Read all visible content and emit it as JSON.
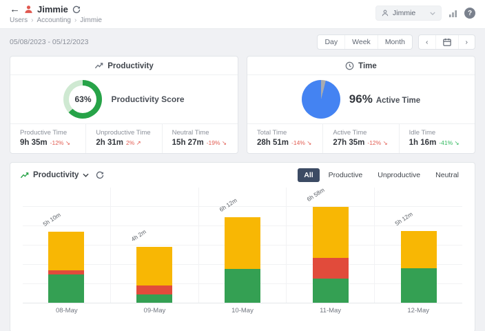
{
  "header": {
    "back_icon": "←",
    "title": "Jimmie",
    "breadcrumb": {
      "items": [
        "Users",
        "Accounting",
        "Jimmie"
      ],
      "separator": "›"
    },
    "user_select": {
      "value": "Jimmie"
    },
    "help_glyph": "?"
  },
  "toolbar": {
    "date_range": "05/08/2023 - 05/12/2023",
    "views": [
      "Day",
      "Week",
      "Month"
    ],
    "prev_glyph": "‹",
    "next_glyph": "›"
  },
  "productivity_card": {
    "title": "Productivity",
    "score": "63%",
    "score_label": "Productivity Score",
    "donut_color": "#27a348",
    "donut_rest_color": "#cfe9d2",
    "stats": [
      {
        "label": "Productive Time",
        "value": "9h 35m",
        "delta": "-12%",
        "arrow": "↘",
        "delta_color": "#e25c51"
      },
      {
        "label": "Unproductive Time",
        "value": "2h 31m",
        "delta": "2%",
        "arrow": "↗",
        "delta_color": "#e25c51"
      },
      {
        "label": "Neutral Time",
        "value": "15h 27m",
        "delta": "-19%",
        "arrow": "↘",
        "delta_color": "#e25c51"
      }
    ]
  },
  "time_card": {
    "title": "Time",
    "percent": "96%",
    "percent_label": "Active Time",
    "pie_color": "#4483f2",
    "pie_rest_color": "#a7abb0",
    "stats": [
      {
        "label": "Total Time",
        "value": "28h 51m",
        "delta": "-14%",
        "arrow": "↘",
        "delta_color": "#e25c51"
      },
      {
        "label": "Active Time",
        "value": "27h 35m",
        "delta": "-12%",
        "arrow": "↘",
        "delta_color": "#e25c51"
      },
      {
        "label": "Idle Time",
        "value": "1h 16m",
        "delta": "-41%",
        "arrow": "↘",
        "delta_color": "#2eb85c"
      }
    ]
  },
  "chart_card": {
    "selector_label": "Productivity",
    "filters": [
      "All",
      "Productive",
      "Unproductive",
      "Neutral"
    ],
    "active_filter": "All"
  },
  "chart_data": {
    "type": "bar",
    "stacked": true,
    "unit": "hours",
    "categories": [
      "08-May",
      "09-May",
      "10-May",
      "11-May",
      "12-May"
    ],
    "series": [
      {
        "name": "Productive",
        "color": "#34a053",
        "values": [
          2.05,
          0.6,
          2.45,
          1.75,
          2.5
        ]
      },
      {
        "name": "Unproductive",
        "color": "#e14b3b",
        "values": [
          0.3,
          0.65,
          0.0,
          1.5,
          0.0
        ]
      },
      {
        "name": "Neutral",
        "color": "#f8b704",
        "values": [
          2.82,
          2.78,
          3.75,
          3.72,
          2.7
        ]
      }
    ],
    "totals": [
      "5h 10m",
      "4h 2m",
      "6h 12m",
      "6h 58m",
      "5h 12m"
    ],
    "ylim": [
      0,
      8.4
    ],
    "grid": true,
    "legend": "none",
    "title": "",
    "xlabel": "",
    "ylabel": ""
  }
}
